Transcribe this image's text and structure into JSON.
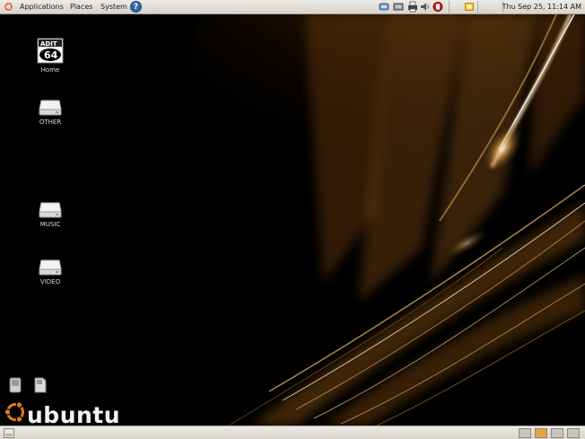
{
  "top_panel": {
    "menus": [
      "Applications",
      "Places",
      "System"
    ],
    "help_icon": "help-icon",
    "tray_icons": [
      "network-icon",
      "printer-icon",
      "volume-icon",
      "update-notifier-icon",
      "notes-icon"
    ],
    "clock": "Thu Sep 25, 11:14 AM"
  },
  "desktop": {
    "icons": [
      {
        "label": "Home",
        "badge": "ADIT",
        "icon": "home-icon"
      },
      {
        "label": "OTHER",
        "icon": "drive-icon"
      },
      {
        "label": "MUSIC",
        "icon": "drive-icon"
      },
      {
        "label": "VIDEO",
        "icon": "drive-icon"
      }
    ],
    "brand": "ubuntu",
    "colors": {
      "accent": "#e07b1a",
      "highlight": "#f8d8a8"
    }
  },
  "bottom_panel": {
    "show_desktop_icon": "show-desktop-icon",
    "workspaces": 4,
    "active_workspace": 2
  }
}
